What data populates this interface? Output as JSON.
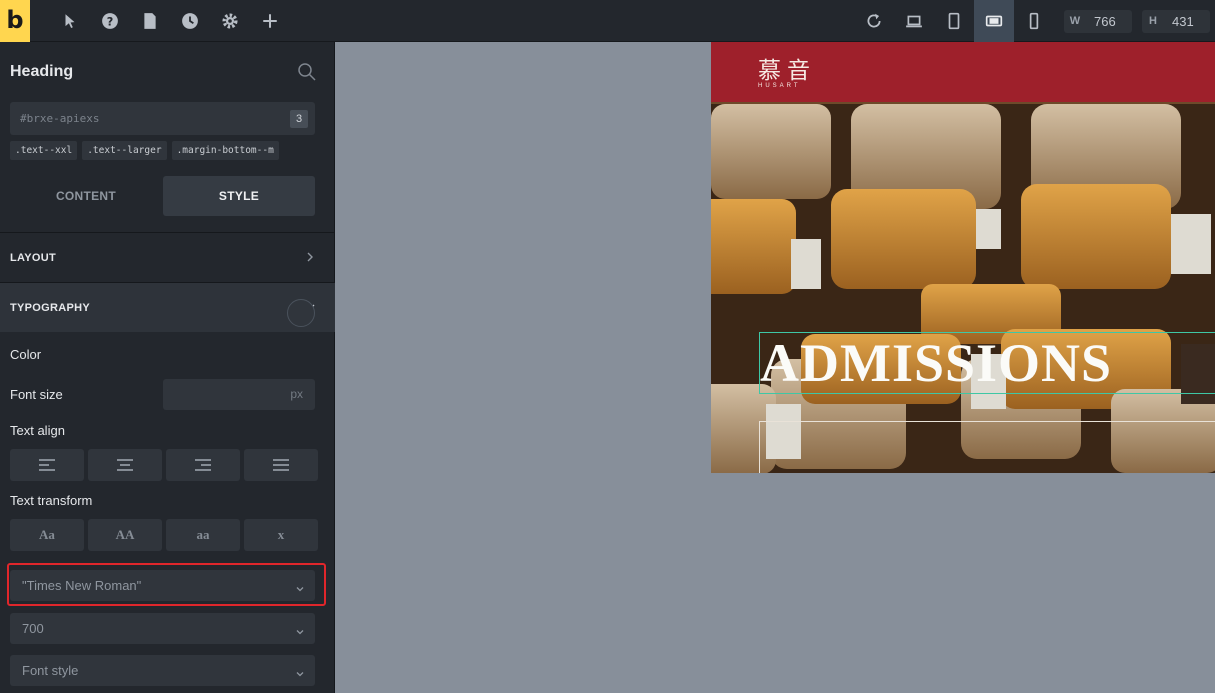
{
  "app": {
    "logo_letter": "b",
    "toolbar_left_icons": [
      "cursor-icon",
      "help-icon",
      "page-icon",
      "history-icon",
      "settings-icon",
      "plus-icon"
    ],
    "toolbar_right_icons": [
      "refresh-icon",
      "laptop-icon",
      "tablet-portrait-icon",
      "tablet-landscape-icon",
      "mobile-icon"
    ],
    "width_label": "W",
    "width_value": "766",
    "height_label": "H",
    "height_value": "431",
    "accent_color": "#ffd64f"
  },
  "panel": {
    "title": "Heading",
    "selector_id": "#brxe-apiexs",
    "selector_count": "3",
    "classes": [
      ".text--xxl",
      ".text--larger",
      ".margin-bottom--m"
    ],
    "tabs": {
      "content": "CONTENT",
      "style": "STYLE",
      "active": "STYLE"
    },
    "sections": {
      "layout": "LAYOUT",
      "typography": "TYPOGRAPHY"
    },
    "typography": {
      "color_label": "Color",
      "font_size_label": "Font size",
      "font_size_unit": "px",
      "text_align_label": "Text align",
      "text_align_options": [
        "align-left-icon",
        "align-center-icon",
        "align-right-icon",
        "align-justify-icon"
      ],
      "text_transform_label": "Text transform",
      "text_transform_options": [
        "Aa",
        "AA",
        "aa",
        "x"
      ],
      "font_family": "\"Times New Roman\"",
      "font_weight": "700",
      "font_style_placeholder": "Font style"
    }
  },
  "preview": {
    "brand_cn": "慕音",
    "brand_en": "HUSART",
    "header_color": "#9e202b",
    "hero_heading": "ADMISSIONS",
    "selection_color": "#3ec7a6"
  }
}
